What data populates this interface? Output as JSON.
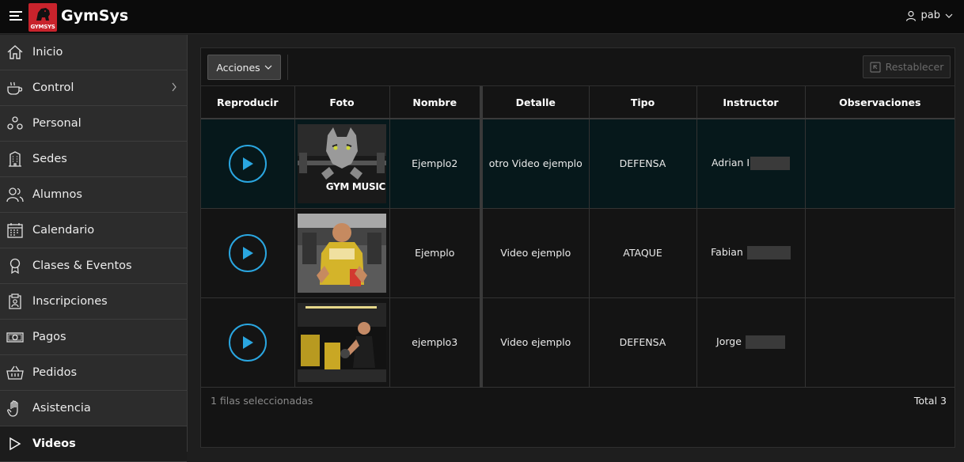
{
  "app": {
    "title": "GymSys",
    "logo_text": "GYMSYS",
    "user": "pab"
  },
  "sidebar": {
    "items": [
      {
        "label": "Inicio",
        "icon": "home-icon"
      },
      {
        "label": "Control",
        "icon": "coffee-cup-icon",
        "has_submenu": true
      },
      {
        "label": "Personal",
        "icon": "people-network-icon"
      },
      {
        "label": "Sedes",
        "icon": "building-icon"
      },
      {
        "label": "Alumnos",
        "icon": "users-icon"
      },
      {
        "label": "Calendario",
        "icon": "calendar-icon"
      },
      {
        "label": "Clases & Eventos",
        "icon": "award-icon"
      },
      {
        "label": "Inscripciones",
        "icon": "clipboard-user-icon"
      },
      {
        "label": "Pagos",
        "icon": "money-icon"
      },
      {
        "label": "Pedidos",
        "icon": "basket-icon"
      },
      {
        "label": "Asistencia",
        "icon": "hand-icon"
      },
      {
        "label": "Videos",
        "icon": "play-icon",
        "active": true
      }
    ]
  },
  "toolbar": {
    "actions_label": "Acciones",
    "reset_label": "Restablecer"
  },
  "table": {
    "headers": {
      "play": "Reproducir",
      "photo": "Foto",
      "name": "Nombre",
      "detail": "Detalle",
      "type": "Tipo",
      "instructor": "Instructor",
      "notes": "Observaciones"
    },
    "rows": [
      {
        "name": "Ejemplo2",
        "detail": "otro Video ejemplo",
        "type": "DEFENSA",
        "instructor": "Adrian I",
        "notes": "",
        "thumb_caption": "GYM MUSIC",
        "selected": true
      },
      {
        "name": "Ejemplo",
        "detail": "Video ejemplo",
        "type": "ATAQUE",
        "instructor": "Fabian",
        "notes": "",
        "thumb_caption": "",
        "selected": false
      },
      {
        "name": "ejemplo3",
        "detail": "Video ejemplo",
        "type": "DEFENSA",
        "instructor": "Jorge",
        "notes": "",
        "thumb_caption": "",
        "selected": false
      }
    ]
  },
  "footer": {
    "selected_text": "1 filas seleccionadas",
    "total_text": "Total 3"
  },
  "colors": {
    "accent": "#2aa6e0",
    "brand": "#c8232c",
    "selected_row": "#06181b"
  }
}
